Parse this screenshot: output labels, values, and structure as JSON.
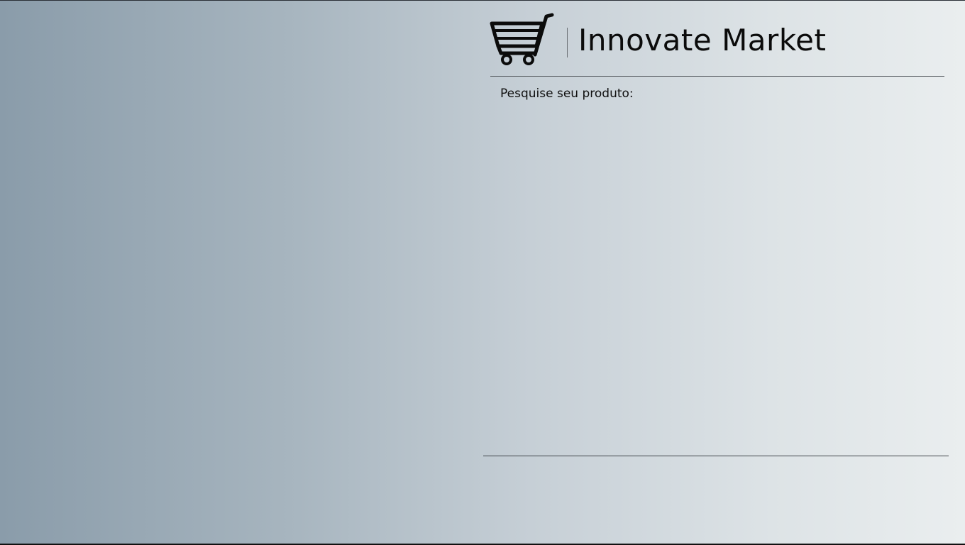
{
  "header": {
    "title": "Innovate Market",
    "logo_icon": "shopping-cart-icon"
  },
  "search": {
    "label": "Pesquise seu produto:"
  },
  "colors": {
    "gradient_left": "#8a9caa",
    "gradient_right": "#eaeeef",
    "text": "#0b0b0b",
    "rule": "#5a5f64"
  }
}
